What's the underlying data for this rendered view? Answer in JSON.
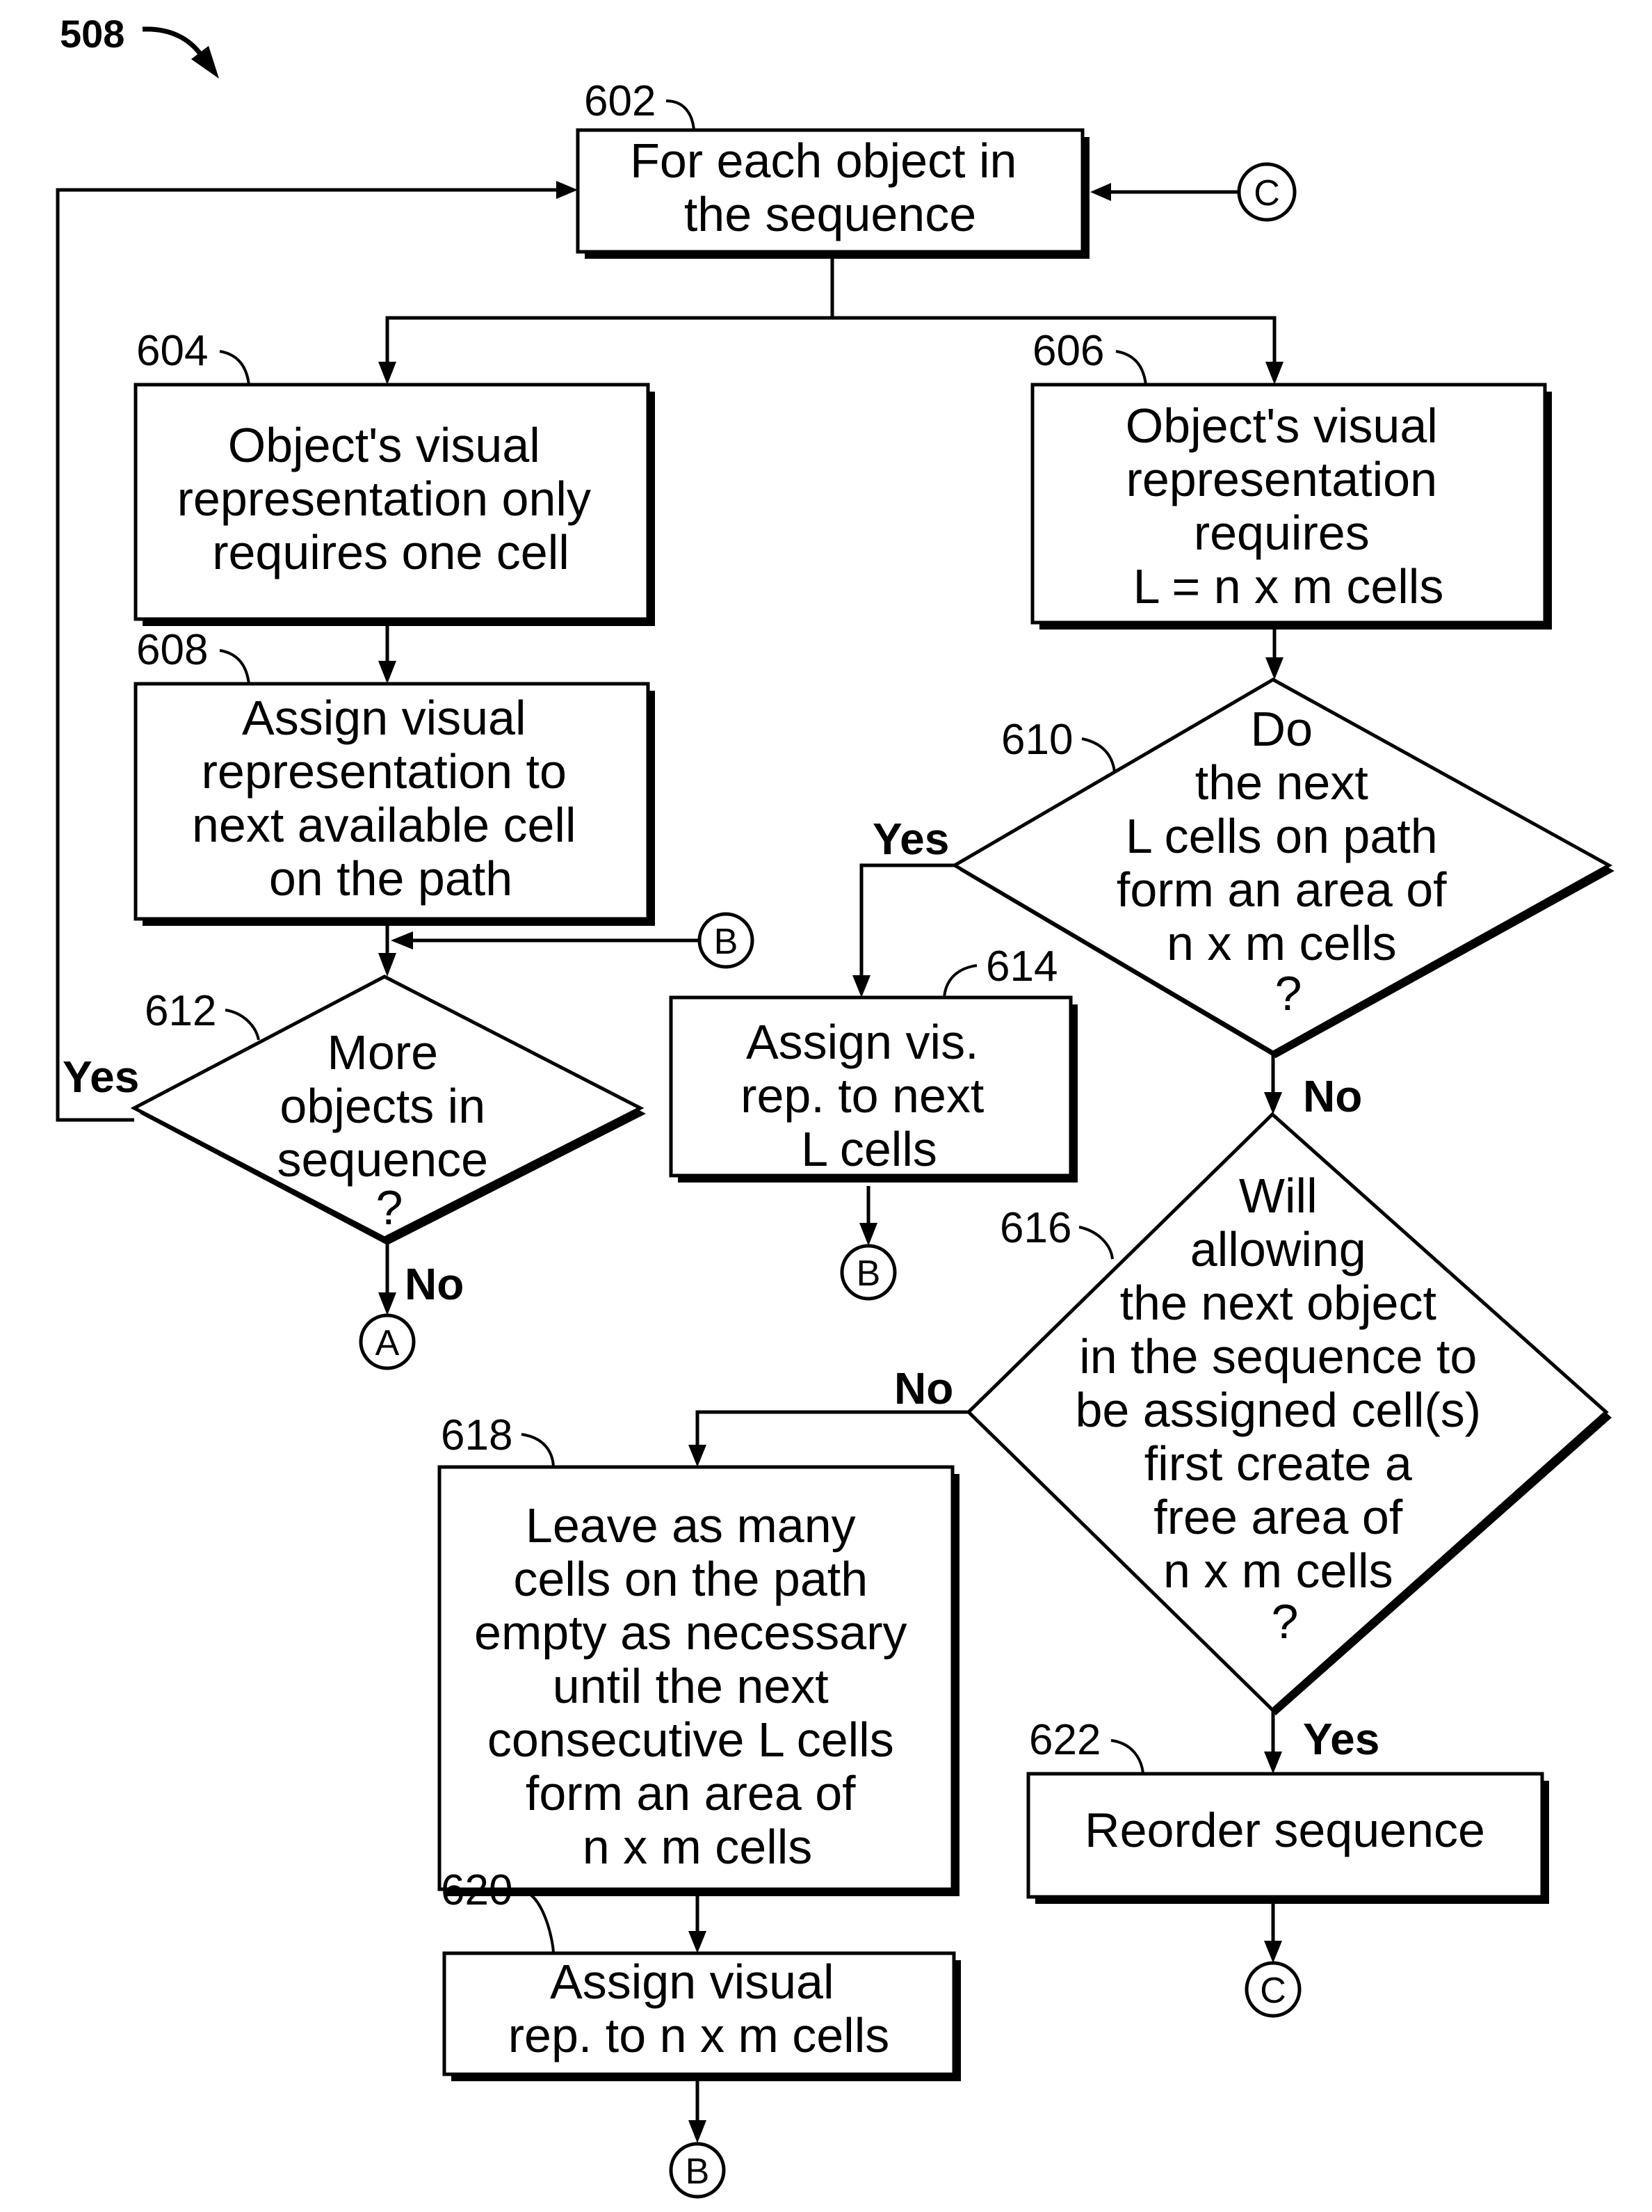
{
  "figure": {
    "label": "508",
    "colors": {
      "ink": "#000000",
      "paper": "#ffffff"
    }
  },
  "nodes": {
    "n602": {
      "ref": "602",
      "type": "process",
      "lines": [
        "For each object in",
        "the sequence"
      ]
    },
    "n604": {
      "ref": "604",
      "type": "process",
      "lines": [
        "Object's visual",
        "representation only",
        "requires one cell"
      ]
    },
    "n606": {
      "ref": "606",
      "type": "process",
      "lines": [
        "Object's visual",
        "representation",
        "requires",
        "L = n x m cells"
      ]
    },
    "n608": {
      "ref": "608",
      "type": "process",
      "lines": [
        "Assign visual",
        "representation to",
        "next available cell",
        "on the path"
      ]
    },
    "n610": {
      "ref": "610",
      "type": "decision",
      "lines": [
        "Do",
        "the next",
        "L cells on path",
        "form an area of",
        "n x m cells",
        "?"
      ]
    },
    "n612": {
      "ref": "612",
      "type": "decision",
      "lines": [
        "More",
        "objects in",
        "sequence",
        "?"
      ]
    },
    "n614": {
      "ref": "614",
      "type": "process",
      "lines": [
        "Assign vis.",
        "rep. to next",
        "L cells"
      ]
    },
    "n616": {
      "ref": "616",
      "type": "decision",
      "lines": [
        "Will",
        "allowing",
        "the next object",
        "in the sequence to",
        "be assigned cell(s)",
        "first create a",
        "free area of",
        "n x m cells",
        "?"
      ]
    },
    "n618": {
      "ref": "618",
      "type": "process",
      "lines": [
        "Leave as many",
        "cells on the path",
        "empty as necessary",
        "until the next",
        "consecutive L cells",
        "form an area of",
        "n x m cells"
      ]
    },
    "n620": {
      "ref": "620",
      "type": "process",
      "lines": [
        "Assign visual",
        "rep. to n x m cells"
      ]
    },
    "n622": {
      "ref": "622",
      "type": "process",
      "lines": [
        "Reorder sequence"
      ]
    }
  },
  "connectors": {
    "c_top": "C",
    "b_in": "B",
    "a_out": "A",
    "b_614": "B",
    "c_622": "C",
    "b_620": "B"
  },
  "edge_labels": {
    "e612_yes": "Yes",
    "e612_no": "No",
    "e610_yes": "Yes",
    "e610_no": "No",
    "e616_no": "No",
    "e616_yes": "Yes"
  }
}
